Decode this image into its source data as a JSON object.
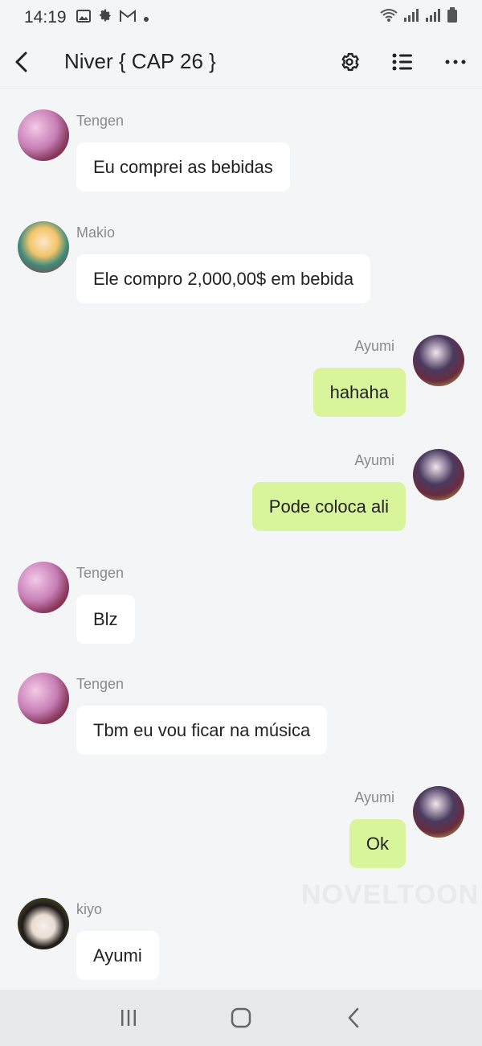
{
  "status_bar": {
    "time": "14:19",
    "left_icons": [
      "image-icon",
      "gear-icon",
      "gmail-icon",
      "dot-icon"
    ],
    "right_icons": [
      "wifi-icon",
      "signal-icon",
      "signal-icon",
      "battery-icon"
    ]
  },
  "header": {
    "title": "Niver { CAP 26 }",
    "buttons": [
      "settings-icon",
      "list-icon",
      "more-icon"
    ]
  },
  "colors": {
    "background": "#f4f5f7",
    "incoming_bubble": "#ffffff",
    "outgoing_bubble": "#d9f59c",
    "username": "#8a8a8a"
  },
  "messages": [
    {
      "side": "left",
      "user": "Tengen",
      "text": "Eu comprei as bebidas"
    },
    {
      "side": "left",
      "user": "Makio",
      "text": "Ele compro 2,000,00$ em bebida"
    },
    {
      "side": "right",
      "user": "Ayumi",
      "text": "hahaha"
    },
    {
      "side": "right",
      "user": "Ayumi",
      "text": "Pode coloca ali"
    },
    {
      "side": "left",
      "user": "Tengen",
      "text": "Blz"
    },
    {
      "side": "left",
      "user": "Tengen",
      "text": "Tbm eu vou ficar na música"
    },
    {
      "side": "right",
      "user": "Ayumi",
      "text": "Ok"
    },
    {
      "side": "left",
      "user": "kiyo",
      "text": "Ayumi"
    }
  ],
  "watermark": "NOVELTOON",
  "nav_bar": [
    "recents-icon",
    "home-icon",
    "back-icon"
  ]
}
